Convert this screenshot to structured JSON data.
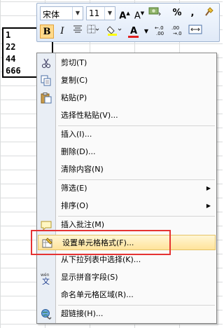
{
  "cells": [
    "1",
    "22",
    "44",
    "666"
  ],
  "toolbar": {
    "font_name": "宋体",
    "font_size": "11",
    "bold": "B",
    "italic": "I",
    "percent": "%",
    "comma": ",",
    "font_color_label": "A"
  },
  "menu": {
    "items": [
      {
        "label": "剪切(T)",
        "icon": "scissors-icon"
      },
      {
        "label": "复制(C)",
        "icon": "copy-icon"
      },
      {
        "label": "粘贴(P)",
        "icon": "paste-icon"
      },
      {
        "label": "选择性粘贴(V)...",
        "icon": ""
      },
      {
        "label": "插入(I)...",
        "icon": ""
      },
      {
        "label": "删除(D)...",
        "icon": ""
      },
      {
        "label": "清除内容(N)",
        "icon": ""
      },
      {
        "label": "筛选(E)",
        "icon": "",
        "submenu": true
      },
      {
        "label": "排序(O)",
        "icon": "",
        "submenu": true
      },
      {
        "label": "插入批注(M)",
        "icon": "comment-icon"
      },
      {
        "label": "设置单元格格式(F)...",
        "icon": "format-cells-icon"
      },
      {
        "label": "从下拉列表中选择(K)...",
        "icon": ""
      },
      {
        "label": "显示拼音字段(S)",
        "icon": "pinyin-icon"
      },
      {
        "label": "命名单元格区域(R)...",
        "icon": ""
      },
      {
        "label": "超链接(H)...",
        "icon": "hyperlink-icon"
      }
    ]
  },
  "colors": {
    "highlight_border": "#e53333",
    "hover": "#ffe39a"
  }
}
